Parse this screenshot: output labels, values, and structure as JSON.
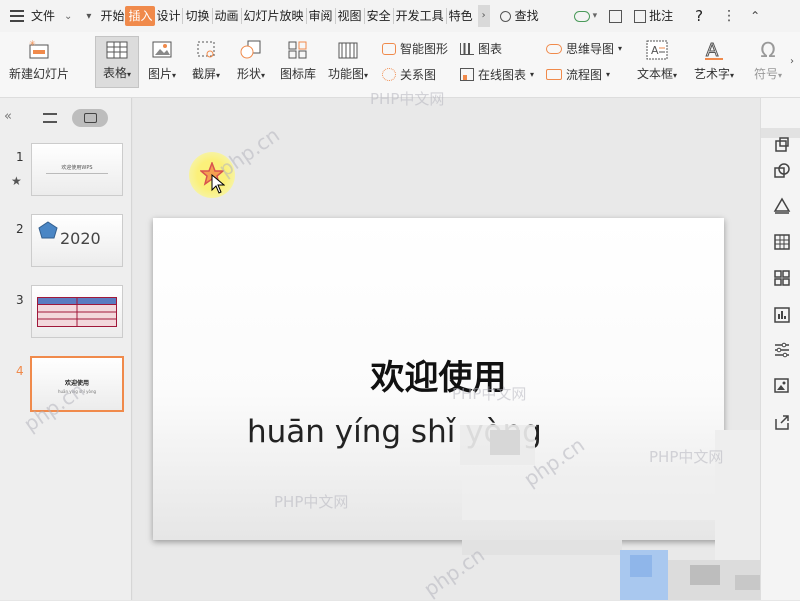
{
  "menubar": {
    "file_label": "文件",
    "tabs": [
      "开始",
      "插入",
      "设计",
      "切换",
      "动画",
      "幻灯片放映",
      "审阅",
      "视图",
      "安全",
      "开发工具",
      "特色"
    ],
    "active_tab": "插入",
    "search_label": "查找",
    "comment_label": "批注",
    "help_label": "?"
  },
  "ribbon": {
    "new_slide": "新建幻灯片",
    "table": "表格",
    "picture": "图片",
    "screenshot": "截屏",
    "shape": "形状",
    "icon_lib": "图标库",
    "function_chart": "功能图",
    "smart_art": "智能图形",
    "chart": "图表",
    "mindmap": "思维导图",
    "relation": "关系图",
    "online_chart": "在线图表",
    "flowchart": "流程图",
    "textbox": "文本框",
    "wordart": "艺术字",
    "symbol": "符号"
  },
  "slides_panel": {
    "numbers": [
      "1",
      "2",
      "3",
      "4"
    ],
    "slide1_title": "欢迎使用WPS",
    "slide2_text": "2020",
    "slide4_title": "欢迎使用",
    "slide4_sub": "huān yíng shǐ yòng"
  },
  "slide": {
    "title": "欢迎使用",
    "subtitle": "huān yíng shǐ yòng"
  },
  "watermarks": {
    "text": "PHP中文网",
    "site": "php.cn"
  },
  "colors": {
    "accent": "#f08a4b",
    "selected_thumb_border": "#f08a4b"
  }
}
